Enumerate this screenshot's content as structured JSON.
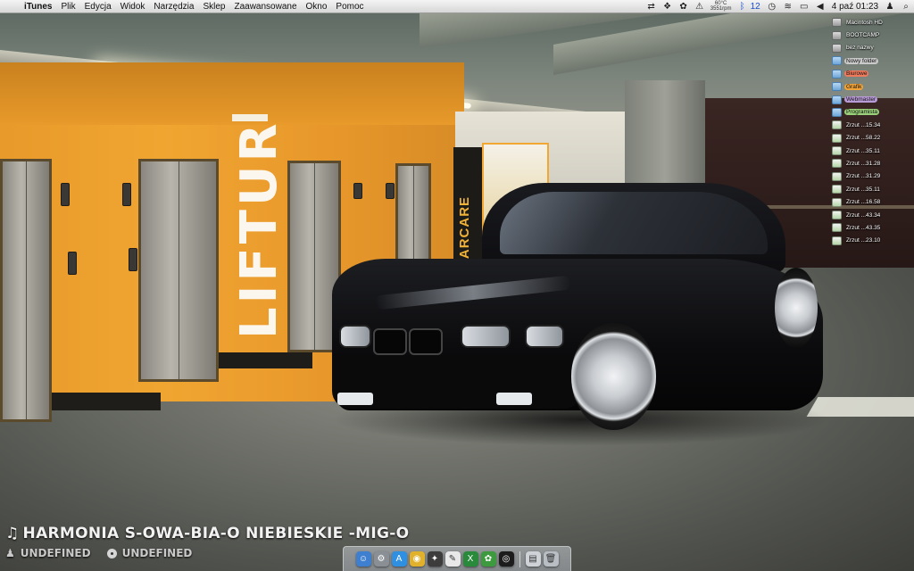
{
  "menubar": {
    "apple_glyph": "",
    "app_name": "iTunes",
    "menus": [
      "Plik",
      "Edycja",
      "Widok",
      "Narzędzia",
      "Sklep",
      "Zaawansowane",
      "Okno",
      "Pomoc"
    ],
    "temperature": {
      "line1": "60°C",
      "line2": "3551rpm"
    },
    "bluetooth_count": "12",
    "datetime": "4 paź  01:23"
  },
  "desktop_icons": [
    {
      "label": "Macintosh HD",
      "kind": "hd",
      "tag_color": ""
    },
    {
      "label": "BOOTCAMP",
      "kind": "hd",
      "tag_color": ""
    },
    {
      "label": "bez nazwy",
      "kind": "hd",
      "tag_color": ""
    },
    {
      "label": "Nowy folder",
      "kind": "folder",
      "tag_color": "#c9c9c9"
    },
    {
      "label": "Biurowe",
      "kind": "folder",
      "tag_color": "#f07a5c"
    },
    {
      "label": "Grafik",
      "kind": "folder",
      "tag_color": "#f2a33a"
    },
    {
      "label": "Webmaster",
      "kind": "folder",
      "tag_color": "#b99bd8"
    },
    {
      "label": "Programista",
      "kind": "folder",
      "tag_color": "#9ad07a"
    },
    {
      "label": "Zrzut ...15.34",
      "kind": "img",
      "tag_color": ""
    },
    {
      "label": "Zrzut ...58.22",
      "kind": "img",
      "tag_color": ""
    },
    {
      "label": "Zrzut ...35.11",
      "kind": "img",
      "tag_color": ""
    },
    {
      "label": "Zrzut ...31.28",
      "kind": "img",
      "tag_color": ""
    },
    {
      "label": "Zrzut ...31.29",
      "kind": "img",
      "tag_color": ""
    },
    {
      "label": "Zrzut ...35.11",
      "kind": "img",
      "tag_color": ""
    },
    {
      "label": "Zrzut ...16.58",
      "kind": "img",
      "tag_color": ""
    },
    {
      "label": "Zrzut ...43.34",
      "kind": "img",
      "tag_color": ""
    },
    {
      "label": "Zrzut ...43.35",
      "kind": "img",
      "tag_color": ""
    },
    {
      "label": "Zrzut ...23.10",
      "kind": "img",
      "tag_color": ""
    }
  ],
  "wallpaper": {
    "wall_text": "LIFTUR",
    "sign_text": "PARCARE"
  },
  "now_playing": {
    "note_glyph": "♫",
    "title": "HARMONIA S-OWA-BIA-O NIEBIESKIE -MIG-O",
    "artist": "UNDEFINED",
    "album": "UNDEFINED"
  },
  "dock": {
    "apps": [
      {
        "name": "finder",
        "color": "#3f7fd0",
        "glyph": "☺"
      },
      {
        "name": "system-preferences",
        "color": "#8a8f96",
        "glyph": "⚙"
      },
      {
        "name": "app-store",
        "color": "#2f8fe0",
        "glyph": "A"
      },
      {
        "name": "chrome",
        "color": "#e2b12b",
        "glyph": "◉"
      },
      {
        "name": "adium",
        "color": "#3c3c3c",
        "glyph": "✦"
      },
      {
        "name": "textedit",
        "color": "#e8e8e8",
        "glyph": "✎"
      },
      {
        "name": "excel",
        "color": "#2a8a3c",
        "glyph": "X"
      },
      {
        "name": "evernote",
        "color": "#3e9a3e",
        "glyph": "✿"
      },
      {
        "name": "steam",
        "color": "#1c1c1c",
        "glyph": "◎"
      }
    ],
    "stacks": [
      {
        "name": "documents-stack",
        "color": "#cfd3d8",
        "glyph": "▤"
      },
      {
        "name": "trash",
        "color": "#b9bec4",
        "glyph": "🗑"
      }
    ]
  }
}
